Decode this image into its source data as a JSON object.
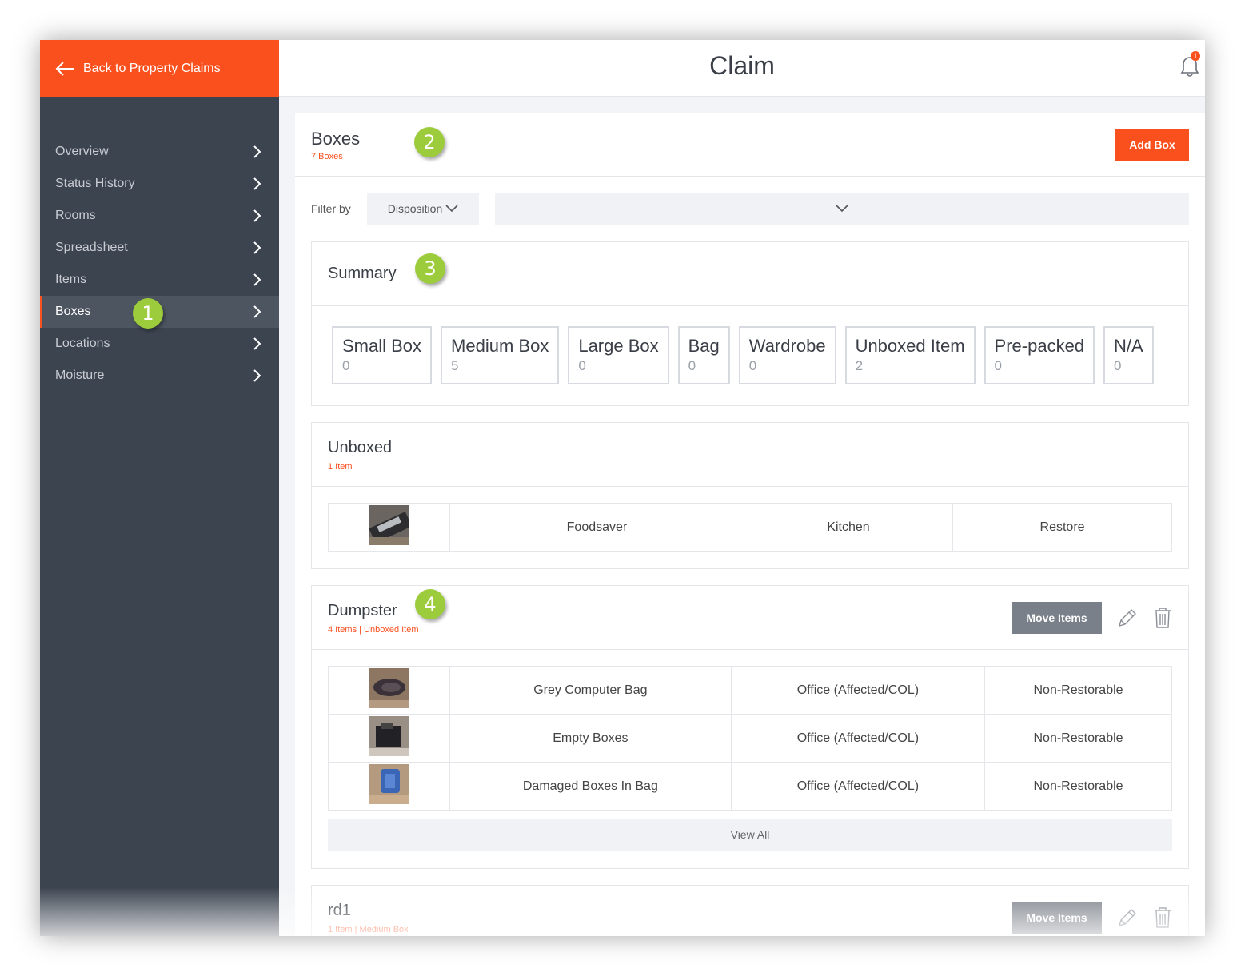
{
  "back_link": "Back to Property Claims",
  "page_title": "Claim",
  "notifications": {
    "count": "1"
  },
  "sidebar": {
    "items": [
      {
        "label": "Overview"
      },
      {
        "label": "Status History"
      },
      {
        "label": "Rooms"
      },
      {
        "label": "Spreadsheet"
      },
      {
        "label": "Items"
      },
      {
        "label": "Boxes",
        "active": true
      },
      {
        "label": "Locations"
      },
      {
        "label": "Moisture"
      }
    ]
  },
  "annotations": [
    "1",
    "2",
    "3",
    "4"
  ],
  "boxes": {
    "title": "Boxes",
    "subtitle": "7 Boxes",
    "add_label": "Add Box"
  },
  "filter": {
    "label": "Filter by",
    "selected": "Disposition",
    "value": ""
  },
  "summary": {
    "title": "Summary",
    "cards": [
      {
        "name": "Small Box",
        "count": "0"
      },
      {
        "name": "Medium Box",
        "count": "5"
      },
      {
        "name": "Large Box",
        "count": "0"
      },
      {
        "name": "Bag",
        "count": "0"
      },
      {
        "name": "Wardrobe",
        "count": "0"
      },
      {
        "name": "Unboxed Item",
        "count": "2"
      },
      {
        "name": "Pre-packed",
        "count": "0"
      },
      {
        "name": "N/A",
        "count": "0"
      }
    ]
  },
  "unboxed": {
    "title": "Unboxed",
    "subtitle": "1 Item",
    "rows": [
      {
        "name": "Foodsaver",
        "location": "Kitchen",
        "disposition": "Restore"
      }
    ]
  },
  "dumpster": {
    "title": "Dumpster",
    "subtitle": "4 Items | Unboxed Item",
    "move_label": "Move Items",
    "rows": [
      {
        "name": "Grey Computer Bag",
        "location": "Office (Affected/COL)",
        "disposition": "Non-Restorable"
      },
      {
        "name": "Empty Boxes",
        "location": "Office (Affected/COL)",
        "disposition": "Non-Restorable"
      },
      {
        "name": "Damaged Boxes In Bag",
        "location": "Office (Affected/COL)",
        "disposition": "Non-Restorable"
      }
    ],
    "view_all": "View All"
  },
  "rd1": {
    "title": "rd1",
    "subtitle": "1 Item | Medium Box",
    "move_label": "Move Items"
  },
  "colors": {
    "accent": "#f9501e",
    "sidebar": "#3c4450",
    "badge": "#9ccc3c"
  },
  "icons": [
    "back-arrow-icon",
    "bell-icon",
    "chevron-right-icon",
    "chevron-down-icon",
    "pencil-icon",
    "trash-icon"
  ]
}
